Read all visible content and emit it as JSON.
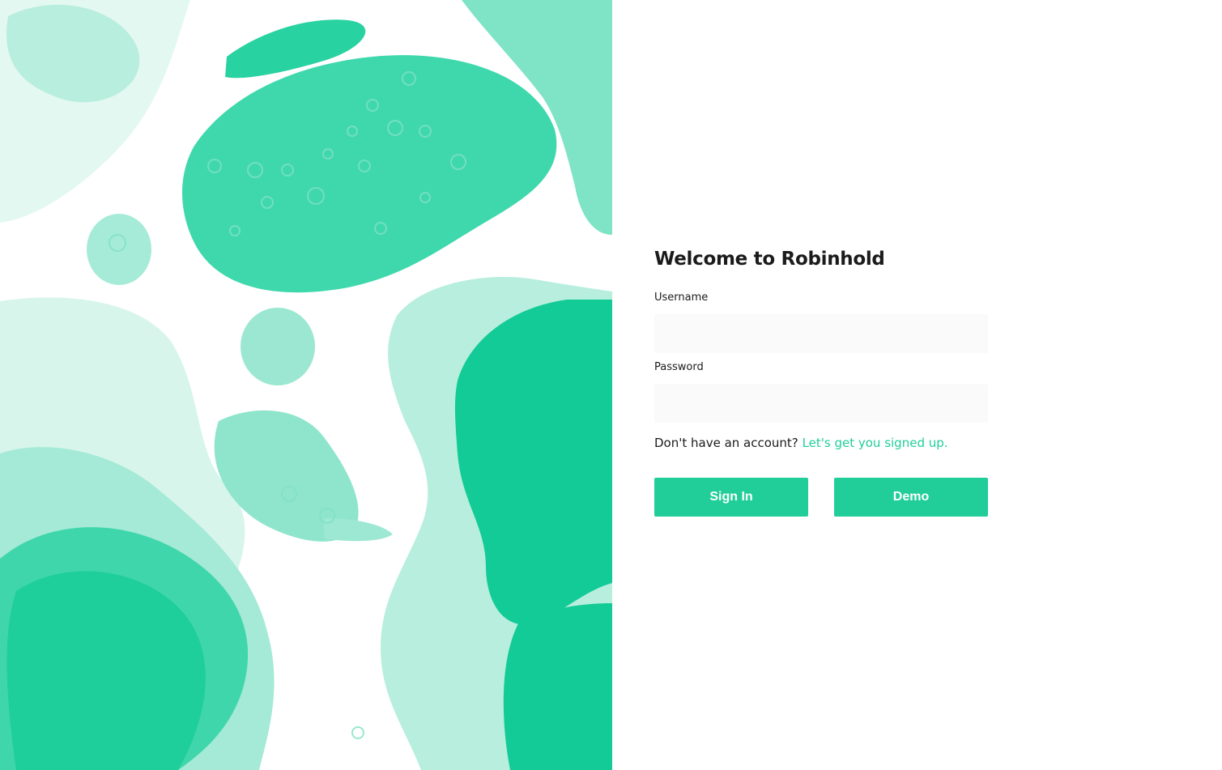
{
  "colors": {
    "accent": "#21ce99",
    "input_background": "#fafafa",
    "text": "#1b1b1b",
    "art_light": "#9de8d2",
    "art_mid": "#5fdcb8",
    "art_deep": "#12cc98"
  },
  "login": {
    "title": "Welcome to Robinhold",
    "username_label": "Username",
    "username_value": "",
    "password_label": "Password",
    "password_value": "",
    "no_account_text": "Don't have an account?",
    "signup_link": "Let's get you signed up.",
    "sign_in_label": "Sign In",
    "demo_label": "Demo"
  }
}
